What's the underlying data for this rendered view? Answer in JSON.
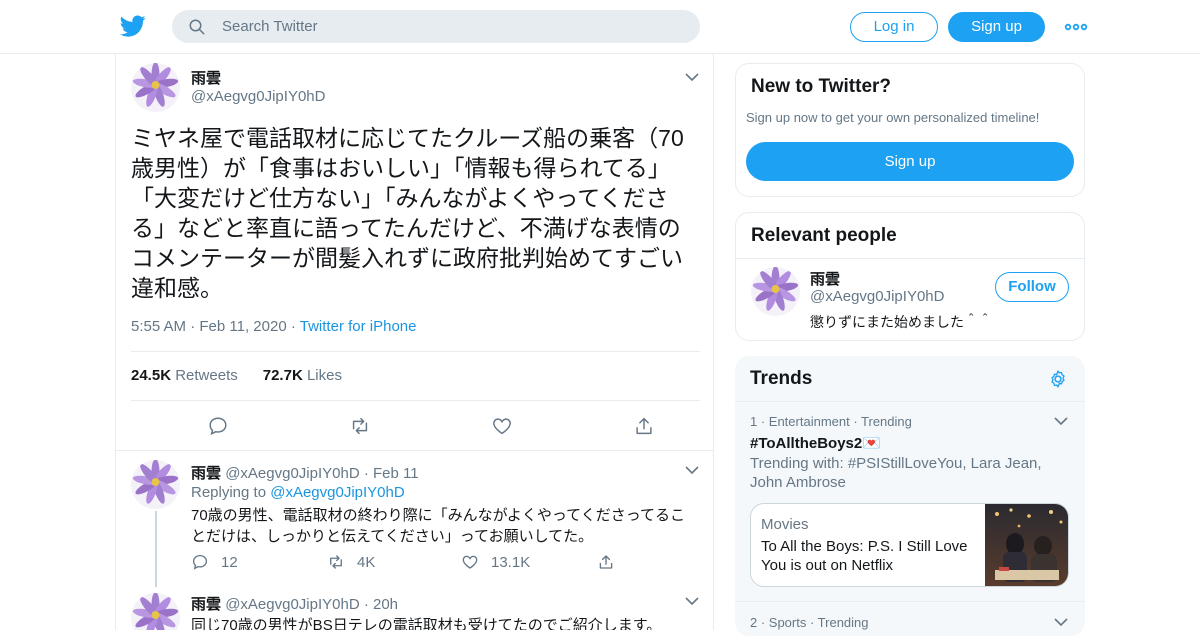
{
  "header": {
    "search_placeholder": "Search Twitter",
    "login_label": "Log in",
    "signup_label": "Sign up"
  },
  "tweet": {
    "name": "雨雲",
    "handle": "@xAegvg0JipIY0hD",
    "text": "ミヤネ屋で電話取材に応じてたクルーズ船の乗客（70歳男性）が「食事はおいしい」「情報も得られてる」「大変だけど仕方ない」「みんながよくやってくださる」などと率直に語ってたんだけど、不満げな表情のコメンテーターが間髪入れずに政府批判始めてすごい違和感。",
    "time": "5:55 AM",
    "date": "Feb 11, 2020",
    "source": "Twitter for iPhone",
    "retweets_count": "24.5K",
    "retweets_label": "Retweets",
    "likes_count": "72.7K",
    "likes_label": "Likes"
  },
  "replies": [
    {
      "name": "雨雲",
      "handle": "@xAegvg0JipIY0hD",
      "when": "Feb 11",
      "replying_prefix": "Replying to",
      "replying_to": "@xAegvg0JipIY0hD",
      "text": "70歳の男性、電話取材の終わり際に「みんながよくやってくださってることだけは、しっかりと伝えてください」ってお願いしてた。",
      "replies": "12",
      "retweets": "4K",
      "likes": "13.1K"
    },
    {
      "name": "雨雲",
      "handle": "@xAegvg0JipIY0hD",
      "when": "20h",
      "text": "同じ70歳の男性がBS日テレの電話取材も受けてたのでご紹介します。"
    }
  ],
  "new_to_twitter": {
    "title": "New to Twitter?",
    "subtitle": "Sign up now to get your own personalized timeline!",
    "button": "Sign up"
  },
  "relevant_people": {
    "title": "Relevant people",
    "name": "雨雲",
    "handle": "@xAegvg0JipIY0hD",
    "bio": "懲りずにまた始めました＾＾",
    "follow_label": "Follow"
  },
  "trends": {
    "title": "Trends",
    "items": [
      {
        "meta": "1 · Entertainment · Trending",
        "tag": "#ToAlltheBoys2💌",
        "with": "Trending with: #PSIStillLoveYou, Lara Jean, John Ambrose",
        "card_category": "Movies",
        "card_text": "To All the Boys: P.S. I Still Love You is out on Netflix"
      },
      {
        "meta": "2 · Sports · Trending"
      }
    ]
  },
  "colors": {
    "accent": "#1da1f2",
    "link": "#1b95e0",
    "secondary_text": "#657786",
    "border": "#e6ecf0"
  }
}
